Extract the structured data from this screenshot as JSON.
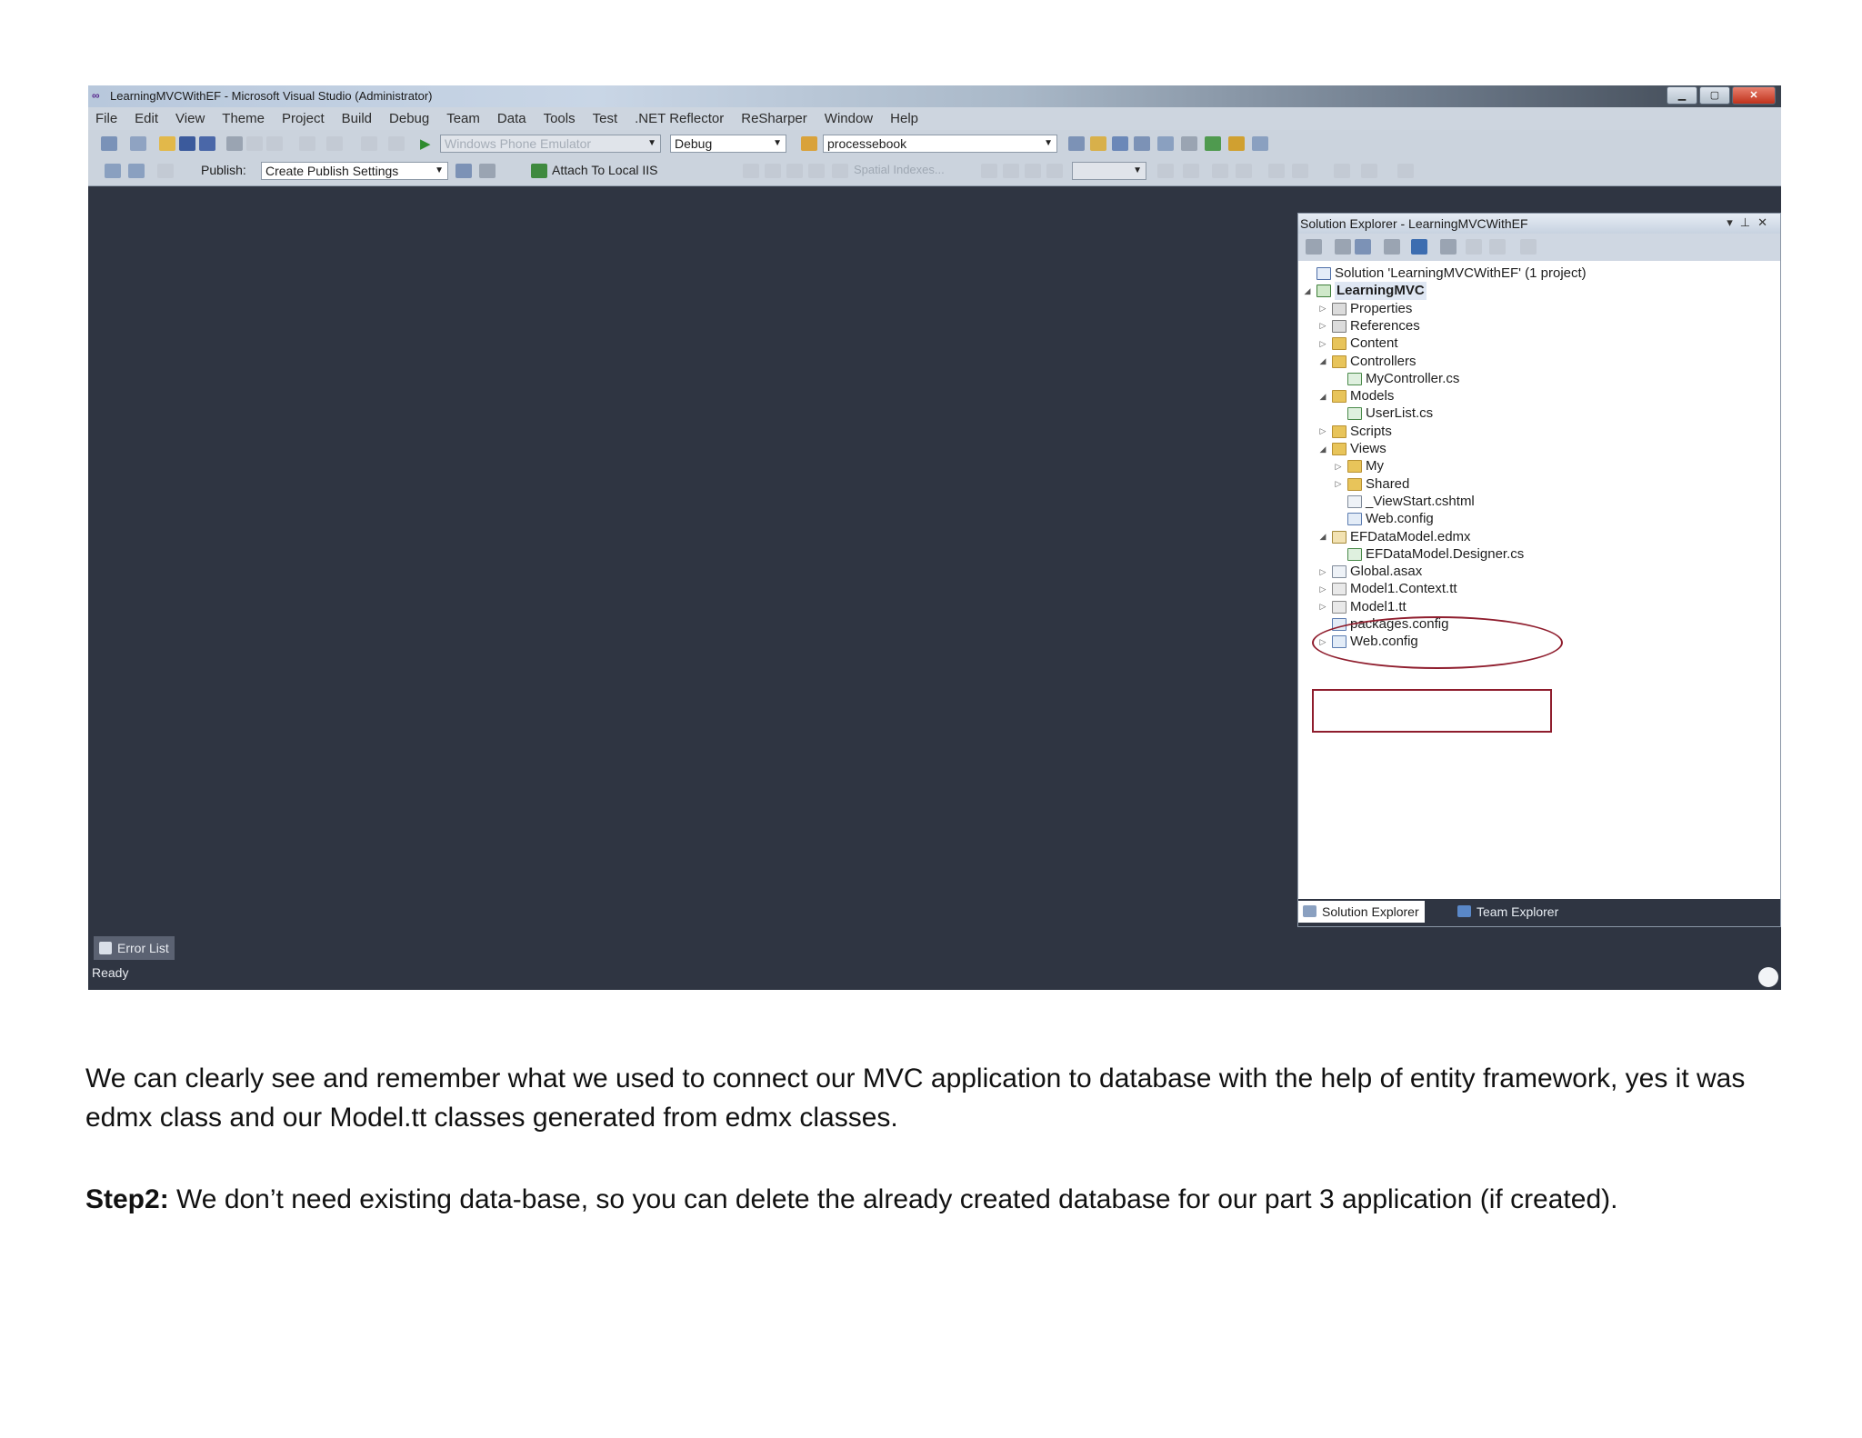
{
  "window": {
    "title": "LearningMVCWithEF - Microsoft Visual Studio (Administrator)"
  },
  "menu": [
    "File",
    "Edit",
    "View",
    "Theme",
    "Project",
    "Build",
    "Debug",
    "Team",
    "Data",
    "Tools",
    "Test",
    ".NET Reflector",
    "ReSharper",
    "Window",
    "Help"
  ],
  "toolbar1": {
    "target_device": "Windows Phone Emulator",
    "configuration": "Debug",
    "search_value": "processebook"
  },
  "toolbar2": {
    "publish_label": "Publish:",
    "publish_value": "Create Publish Settings",
    "attach_label": "Attach To Local IIS",
    "spatial_label": "Spatial Indexes..."
  },
  "solution_explorer": {
    "title": "Solution Explorer - LearningMVCWithEF",
    "items": [
      {
        "label": "Solution 'LearningMVCWithEF' (1 project)",
        "level": 0,
        "expander": "",
        "icon": "solution"
      },
      {
        "label": "LearningMVC",
        "level": 0,
        "expander": "expanded",
        "icon": "project"
      },
      {
        "label": "Properties",
        "level": 1,
        "expander": "collapsed",
        "icon": "properties"
      },
      {
        "label": "References",
        "level": 1,
        "expander": "collapsed",
        "icon": "references"
      },
      {
        "label": "Content",
        "level": 1,
        "expander": "collapsed",
        "icon": "folder"
      },
      {
        "label": "Controllers",
        "level": 1,
        "expander": "expanded",
        "icon": "folder"
      },
      {
        "label": "MyController.cs",
        "level": 2,
        "expander": "",
        "icon": "cs-file"
      },
      {
        "label": "Models",
        "level": 1,
        "expander": "expanded",
        "icon": "folder"
      },
      {
        "label": "UserList.cs",
        "level": 2,
        "expander": "",
        "icon": "cs-file"
      },
      {
        "label": "Scripts",
        "level": 1,
        "expander": "collapsed",
        "icon": "folder"
      },
      {
        "label": "Views",
        "level": 1,
        "expander": "expanded",
        "icon": "folder"
      },
      {
        "label": "My",
        "level": 2,
        "expander": "collapsed",
        "icon": "folder"
      },
      {
        "label": "Shared",
        "level": 2,
        "expander": "collapsed",
        "icon": "folder"
      },
      {
        "label": "_ViewStart.cshtml",
        "level": 2,
        "expander": "",
        "icon": "file"
      },
      {
        "label": "Web.config",
        "level": 2,
        "expander": "",
        "icon": "config"
      },
      {
        "label": "EFDataModel.edmx",
        "level": 1,
        "expander": "expanded",
        "icon": "edmx"
      },
      {
        "label": "EFDataModel.Designer.cs",
        "level": 2,
        "expander": "",
        "icon": "cs-file"
      },
      {
        "label": "Global.asax",
        "level": 1,
        "expander": "collapsed",
        "icon": "file"
      },
      {
        "label": "Model1.Context.tt",
        "level": 1,
        "expander": "collapsed",
        "icon": "tt"
      },
      {
        "label": "Model1.tt",
        "level": 1,
        "expander": "collapsed",
        "icon": "tt"
      },
      {
        "label": "packages.config",
        "level": 1,
        "expander": "",
        "icon": "config"
      },
      {
        "label": "Web.config",
        "level": 1,
        "expander": "collapsed",
        "icon": "config"
      }
    ],
    "tabs": [
      "Solution Explorer",
      "Team Explorer"
    ]
  },
  "error_list_label": "Error List",
  "status_text": "Ready",
  "annotation_color": "#8f1d2d",
  "document": {
    "paragraph1": "We can clearly see and remember what we used to connect our MVC application to database with the help of entity framework, yes it was edmx class and our Model.tt classes generated from edmx classes.",
    "step_label": "Step2:",
    "step_text": " We don’t need existing data-base, so you can delete the already created database for our part 3 application (if created)."
  }
}
